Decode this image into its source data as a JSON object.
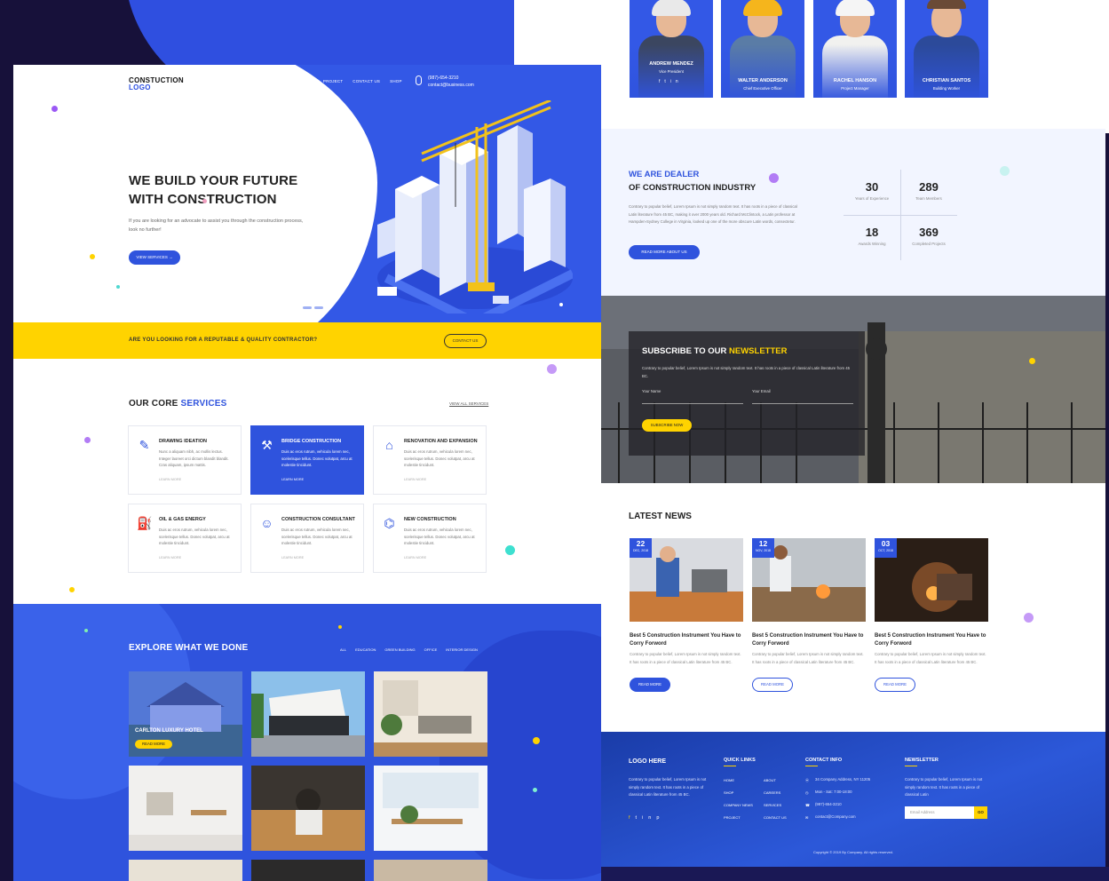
{
  "hero": {
    "logo_line1": "CONSTUCTION",
    "logo_line2": "LOGO",
    "nav": [
      "HOME",
      "PAGE",
      "SERVICES",
      "BLOG",
      "PROJECT",
      "CONTACT US",
      "SHOP"
    ],
    "phone": "(987)-654-3210",
    "email": "contact@business.com",
    "title_line1": "WE BUILD YOUR FUTURE",
    "title_line2": "WITH CONSTRUCTION",
    "text": "If you are looking for an advocate to assist you through the construction process, look no further!",
    "cta": "VIEW SERVICES →"
  },
  "banner": {
    "text": "ARE YOU LOOKING FOR A REPUTABLE & QUALITY CONTRACTOR?",
    "cta": "CONTACT US"
  },
  "services": {
    "title_plain": "OUR CORE ",
    "title_accent": "SERVICES",
    "view_all": "VIEW ALL SERVICES",
    "learn_more": "LEARN MORE",
    "items": [
      {
        "title": "DRAWING IDEATION",
        "text": "Nunc a aliquam nibh, ac mollis lectus. Integer laoreet orci dictum blandit blandit. Cras aliquam, ipsum mattis.",
        "icon": "drawing-tools-icon",
        "glyph": "✎"
      },
      {
        "title": "BRIDGE CONSTRUCTION",
        "text": "Duis ac eros rutrum, vehicula lorem nec, scelerisque tellus. Donec volutpat, arcu at molestie tincidunt.",
        "icon": "bridge-icon",
        "glyph": "⚒"
      },
      {
        "title": "RENOVATION AND EXPANSION",
        "text": "Duis ac eros rutrum, vehicula lorem nec, scelerisque tellus. Donec volutpat, arcu at molestie tincidunt.",
        "icon": "renovation-icon",
        "glyph": "⌂"
      },
      {
        "title": "OIL & GAS ENERGY",
        "text": "Duis ac eros rutrum, vehicula lorem nec, scelerisque tellus. Donec volutpat, arcu at molestie tincidunt.",
        "icon": "oil-gas-icon",
        "glyph": "⛽"
      },
      {
        "title": "CONSTRUCTION CONSULTANT",
        "text": "Duis ac eros rutrum, vehicula lorem nec, scelerisque tellus. Donec volutpat, arcu at molestie tincidunt.",
        "icon": "consultant-icon",
        "glyph": "☺"
      },
      {
        "title": "NEW CONSTRUCTION",
        "text": "Duis ac eros rutrum, vehicula lorem nec, scelerisque tellus. Donec volutpat, arcu at molestie tincidunt.",
        "icon": "new-construction-icon",
        "glyph": "⌬"
      }
    ]
  },
  "explore": {
    "title": "EXPLORE WHAT WE DONE",
    "filters": [
      "ALL",
      "EDUCATION",
      "GREEN BUILDING",
      "OFFICE",
      "INTERIOR DESIGN"
    ],
    "featured_title": "CARLTON LUXURY HOTEL",
    "featured_cta": "READ MORE"
  },
  "team": [
    {
      "name": "ANDREW MENDEZ",
      "role": "Vice President"
    },
    {
      "name": "WALTER ANDERSON",
      "role": "Chief Executive Officer"
    },
    {
      "name": "RACHEL HANSON",
      "role": "Project Manager"
    },
    {
      "name": "CHRISTIAN SANTOS",
      "role": "Building Worker"
    }
  ],
  "dealer": {
    "title_accent": "WE ARE DEALER",
    "title_plain": "OF CONSTRUCTION INDUSTRY",
    "text": "Contrary to popular belief, Lorem Ipsum is not simply random text. It has roots in a piece of classical Latin literature from 45 BC, making it over 2000 years old. Richard McClintock, a Latin professor at Hampden-Sydney College in Virginia, looked up one of the more obscure Latin words, consectetur.",
    "cta": "READ MORE ABOUT US",
    "stats": [
      {
        "value": "30",
        "label": "Years of Experience"
      },
      {
        "value": "289",
        "label": "Team Members"
      },
      {
        "value": "18",
        "label": "Awards Winning"
      },
      {
        "value": "369",
        "label": "Completed Projects"
      }
    ]
  },
  "newsletter": {
    "title_plain": "SUBSCRIBE TO OUR ",
    "title_accent": "NEWSLETTER",
    "text": "Contrary to popular belief, Lorem Ipsum is not simply random text. It has roots in a piece of classical Latin literature from 45 BC.",
    "name_placeholder": "Your Name",
    "email_placeholder": "Your Email",
    "cta": "SUBSCRIBE NOW"
  },
  "news": {
    "title": "LATEST NEWS",
    "cta": "READ MORE",
    "items": [
      {
        "day": "22",
        "month": "DEC, 2018",
        "title": "Best 5 Construction Instrument You Have to Corry Forword",
        "text": "Contrary to popular belief, Lorem Ipsum is not simply random text. It has roots in a piece of classical Latin literature from 45 BC."
      },
      {
        "day": "12",
        "month": "NOV, 2018",
        "title": "Best 5 Construction Instrument You Have to Corry Forword",
        "text": "Contrary to popular belief, Lorem Ipsum is not simply random text. It has roots in a piece of classical Latin literature from 45 BC."
      },
      {
        "day": "03",
        "month": "OCT, 2018",
        "title": "Best 5 Construction Instrument You Have to Corry Forword",
        "text": "Contrary to popular belief, Lorem Ipsum is not simply random text. It has roots in a piece of classical Latin literature from 45 BC."
      }
    ]
  },
  "footer": {
    "logo": "LOGO HERE",
    "about": "Contrary to popular belief, Lorem Ipsum is not simply random text. It has roots in a piece of classical Latin literature from 45 BC.",
    "quick_links_title": "QUICK LINKS",
    "links_col1": [
      "HOME",
      "SHOP",
      "COMPANY NEWS",
      "PROJECT"
    ],
    "links_col2": [
      "ABOUT",
      "CAREERS",
      "SERVICES",
      "CONTACT US"
    ],
    "contact_title": "CONTACT INFO",
    "address": "34 Company Address, NY 11205",
    "hours": "Mon - Sat: 7:00-18:00",
    "phone": "(987)-654-3210",
    "email": "contact@Company.com",
    "newsletter_title": "NEWSLETTER",
    "newsletter_text": "Contrary to popular belief, Lorem Ipsum is not simply random text. It has roots in a piece of classical Latin",
    "email_placeholder": "Email Address",
    "go": "GO",
    "copyright": "Copyright © 2019 By Company. All rights reserved."
  },
  "colors": {
    "primary": "#2f53dd",
    "accent": "#ffd300",
    "dark": "#17113a"
  }
}
